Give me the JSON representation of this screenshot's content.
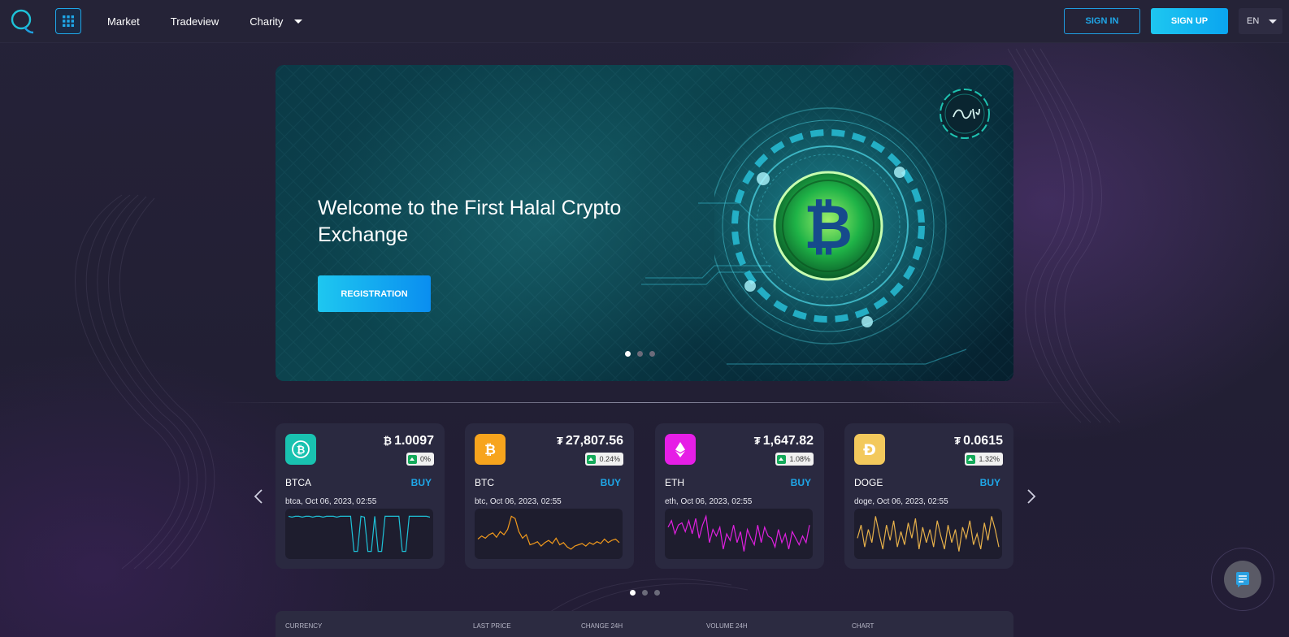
{
  "header": {
    "nav": [
      {
        "label": "Market"
      },
      {
        "label": "Tradeview"
      },
      {
        "label": "Charity"
      }
    ],
    "signin_label": "SIGN IN",
    "signup_label": "SIGN UP",
    "lang": "EN"
  },
  "hero": {
    "title": "Welcome to the First Halal Crypto Exchange",
    "button_label": "REGISTRATION",
    "slide_count": 3,
    "active_slide": 1
  },
  "colors": {
    "accent": "#1fa7e8",
    "up": "#14a95a",
    "btca": "#19c2b0",
    "btc": "#f7a41d",
    "eth": "#e61ee6",
    "doge": "#f3c95c"
  },
  "cards": [
    {
      "symbol": "BTCA",
      "currency_symbol": "₿",
      "price": "1.0097",
      "change": "0%",
      "buy_label": "BUY",
      "stamp": "btca, Oct 06, 2023, 02:55",
      "icon": "btca-coin-icon",
      "line_color": "#1ec2d8",
      "series": [
        0.1,
        0.12,
        0.1,
        0.1,
        0.12,
        0.1,
        0.1,
        0.12,
        0.1,
        0.1,
        0.12,
        0.1,
        0.1,
        0.1,
        0.12,
        0.1,
        0.1,
        0.1,
        0.1,
        0.9,
        0.9,
        0.1,
        0.12,
        0.9,
        0.9,
        0.1,
        0.9,
        0.9,
        0.1,
        0.1,
        0.1,
        0.1,
        0.1,
        0.9,
        0.9,
        0.1,
        0.1,
        0.1,
        0.1,
        0.1,
        0.1,
        0.12
      ]
    },
    {
      "symbol": "BTC",
      "currency_symbol": "₮",
      "price": "27,807.56",
      "change": "0.24%",
      "buy_label": "BUY",
      "stamp": "btc, Oct 06, 2023, 02:55",
      "icon": "btc-coin-icon",
      "line_color": "#f29a1c",
      "series": [
        0.62,
        0.55,
        0.6,
        0.52,
        0.48,
        0.58,
        0.45,
        0.52,
        0.4,
        0.1,
        0.15,
        0.45,
        0.6,
        0.52,
        0.75,
        0.72,
        0.68,
        0.78,
        0.7,
        0.65,
        0.72,
        0.6,
        0.75,
        0.7,
        0.8,
        0.85,
        0.78,
        0.75,
        0.72,
        0.78,
        0.7,
        0.74,
        0.68,
        0.72,
        0.62,
        0.7,
        0.65,
        0.62,
        0.7
      ]
    },
    {
      "symbol": "ETH",
      "currency_symbol": "₮",
      "price": "1,647.82",
      "change": "1.08%",
      "buy_label": "BUY",
      "stamp": "eth, Oct 06, 2023, 02:55",
      "icon": "eth-coin-icon",
      "line_color": "#e020e0",
      "series": [
        0.35,
        0.2,
        0.5,
        0.3,
        0.25,
        0.45,
        0.2,
        0.5,
        0.15,
        0.6,
        0.3,
        0.1,
        0.7,
        0.4,
        0.55,
        0.35,
        0.85,
        0.5,
        0.65,
        0.3,
        0.7,
        0.45,
        0.9,
        0.4,
        0.6,
        0.75,
        0.3,
        0.7,
        0.35,
        0.55,
        0.6,
        0.8,
        0.4,
        0.7,
        0.5,
        0.85,
        0.45,
        0.6,
        0.75,
        0.55,
        0.7,
        0.3
      ]
    },
    {
      "symbol": "DOGE",
      "currency_symbol": "₮",
      "price": "0.0615",
      "change": "1.32%",
      "buy_label": "BUY",
      "stamp": "doge, Oct 06, 2023, 02:55",
      "icon": "doge-coin-icon",
      "line_color": "#e6b04a",
      "series": [
        0.6,
        0.3,
        0.8,
        0.4,
        0.7,
        0.1,
        0.5,
        0.85,
        0.3,
        0.65,
        0.2,
        0.8,
        0.45,
        0.75,
        0.25,
        0.6,
        0.15,
        0.85,
        0.35,
        0.7,
        0.4,
        0.8,
        0.2,
        0.55,
        0.85,
        0.3,
        0.7,
        0.4,
        0.9,
        0.35,
        0.6,
        0.2,
        0.75,
        0.5,
        0.85,
        0.25,
        0.65,
        0.1,
        0.4,
        0.8
      ]
    }
  ],
  "cards_pager": {
    "count": 3,
    "active": 1
  },
  "table": {
    "headers": [
      "Currency",
      "Last price",
      "Change 24h",
      "Volume 24h",
      "Chart"
    ]
  }
}
